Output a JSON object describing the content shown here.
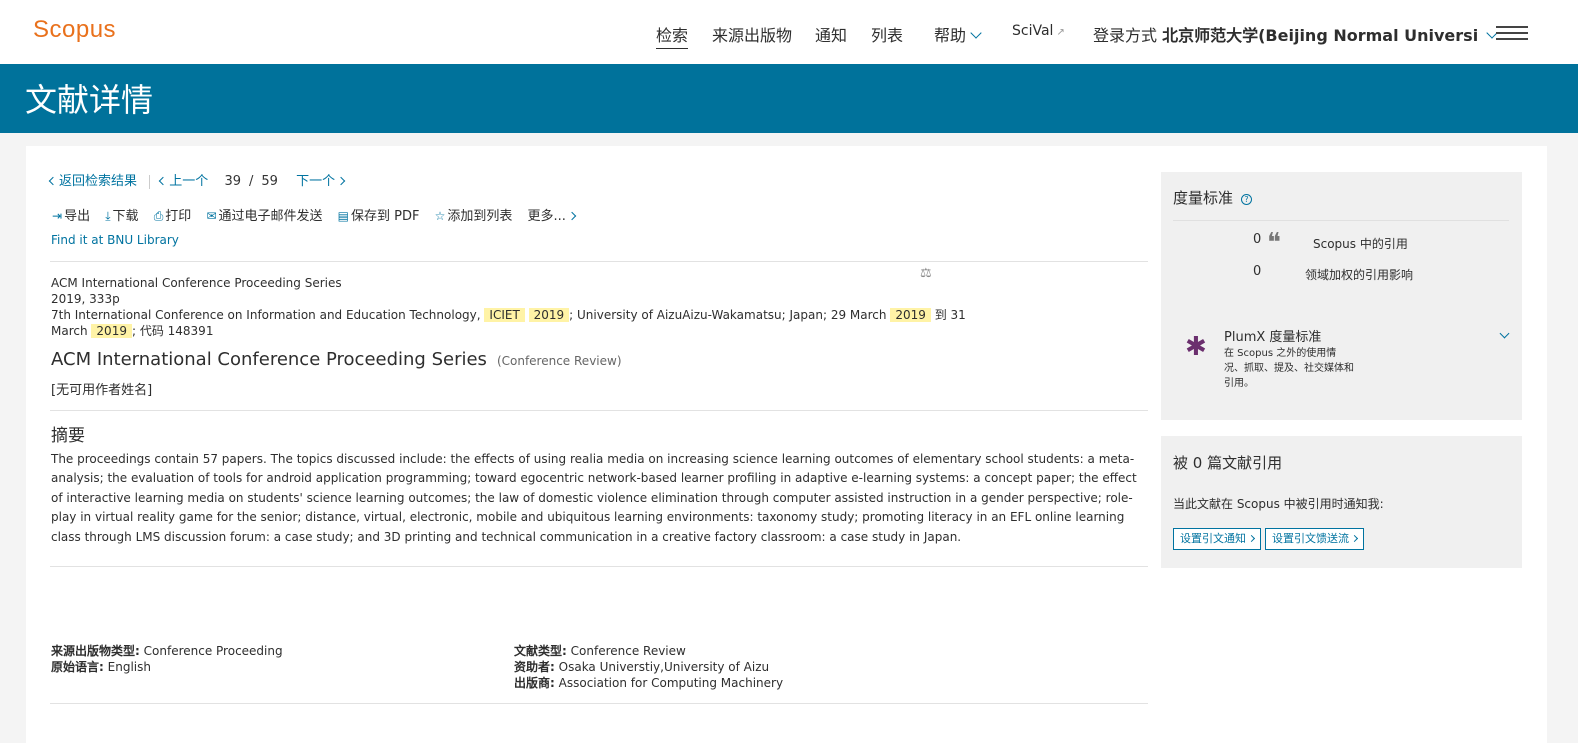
{
  "header": {
    "logo": "Scopus",
    "nav": {
      "search": "检索",
      "sources": "来源出版物",
      "alerts": "通知",
      "lists": "列表",
      "help": "帮助",
      "scival": "SciVal",
      "login_prefix": "登录方式",
      "login_institution": "北京师范大学(Beijing Normal Universi"
    }
  },
  "banner": {
    "title": "文献详情"
  },
  "breadcrumb": {
    "back": "返回检索结果",
    "prev": "上一个",
    "current": "39",
    "slash": "/",
    "total": "59",
    "next": "下一个"
  },
  "actions": {
    "export": "导出",
    "download": "下载",
    "print": "打印",
    "email": "通过电子邮件发送",
    "save_pdf": "保存到 PDF",
    "add_list": "添加到列表",
    "more": "更多..."
  },
  "find_library": "Find it at BNU Library",
  "source": {
    "series": "ACM International Conference Proceeding Series",
    "year_pages": "2019, 333p",
    "conf_prefix": "7th International Conference on Information and Education Technology,",
    "hl1": "ICIET",
    "hl2": "2019",
    "conf_mid1": "; University of AizuAizu-Wakamatsu; Japan; 29 March",
    "hl3": "2019",
    "conf_mid2": "到 31 March",
    "hl4": "2019",
    "conf_suffix": "; 代码 148391"
  },
  "document": {
    "title": "ACM International Conference Proceeding Series",
    "type": "(Conference Review)",
    "authors": "[无可用作者姓名]"
  },
  "abstract": {
    "heading": "摘要",
    "text": "The proceedings contain 57 papers. The topics discussed include: the effects of using realia media on increasing science learning outcomes of elementary school students: a meta-analysis; the evaluation of tools for android application programming; toward egocentric network-based learner profiling in adaptive e-learning systems: a concept paper; the effect of interactive learning media on students' science learning outcomes; the law of domestic violence elimination through computer assisted instruction in a gender perspective; role-play in virtual reality game for the senior; distance, virtual, electronic, mobile and ubiquitous learning environments: taxonomy study; promoting literacy in an EFL online learning class through LMS discussion forum: a case study; and 3D printing and technical communication in a creative factory classroom: a case study in Japan."
  },
  "metadata": {
    "source_type_label": "来源出版物类型:",
    "source_type": "Conference Proceeding",
    "language_label": "原始语言:",
    "language": "English",
    "doc_type_label": "文献类型:",
    "doc_type": "Conference Review",
    "sponsor_label": "资助者:",
    "sponsor": "Osaka Universtiy,University of Aizu",
    "publisher_label": "出版商:",
    "publisher": "Association for Computing Machinery"
  },
  "metrics": {
    "title": "度量标准",
    "help": "?",
    "citations_count": "0",
    "citations_label": "Scopus 中的引用",
    "fwci_count": "0",
    "fwci_label": "领域加权的引用影响",
    "plumx_title": "PlumX 度量标准",
    "plumx_desc": "在 Scopus 之外的使用情况、抓取、提及、社交媒体和引用。"
  },
  "cited_by": {
    "title": "被 0 篇文献引用",
    "notify": "当此文献在 Scopus 中被引用时通知我:",
    "btn_alert": "设置引文通知",
    "btn_feed": "设置引文馈送流"
  },
  "colors": {
    "brand": "#e9711c",
    "banner": "#00729b",
    "link": "#0073a0",
    "highlight": "#fff3a6"
  }
}
